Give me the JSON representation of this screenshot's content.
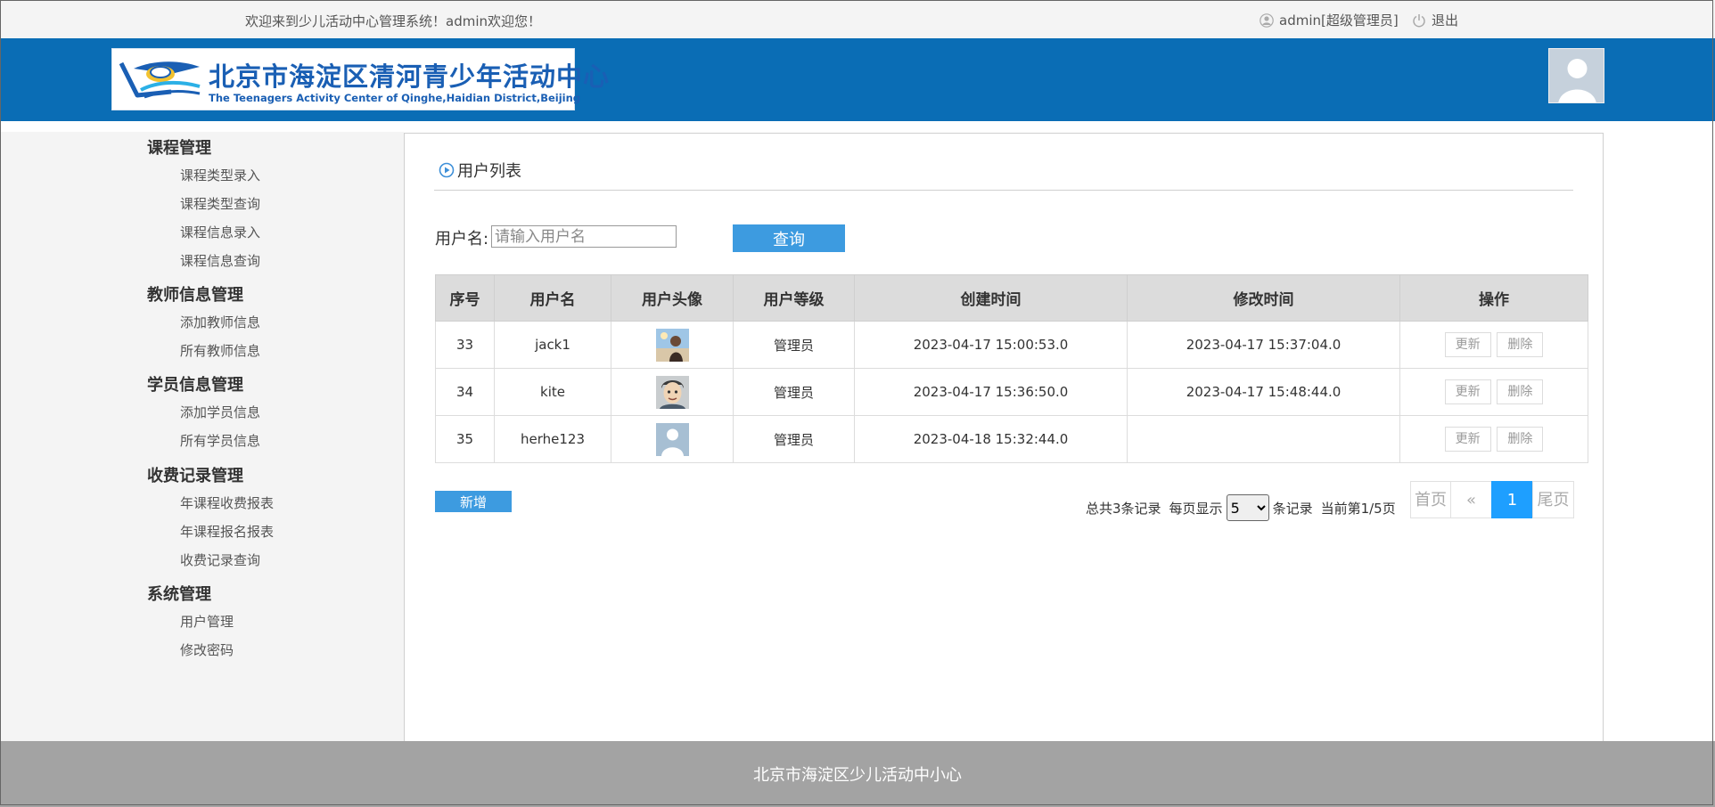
{
  "topbar": {
    "welcome": "欢迎来到少儿活动中心管理系统！admin欢迎您！",
    "user": "admin[超级管理员]",
    "logout": "退出"
  },
  "header": {
    "logo_cn": "北京市海淀区清河青少年活动中心",
    "logo_en": "The Teenagers Activity Center of Qinghe,Haidian District,Beijing"
  },
  "sidebar": {
    "groups": [
      {
        "title": "课程管理",
        "items": [
          "课程类型录入",
          "课程类型查询",
          "课程信息录入",
          "课程信息查询"
        ]
      },
      {
        "title": "教师信息管理",
        "items": [
          "添加教师信息",
          "所有教师信息"
        ]
      },
      {
        "title": "学员信息管理",
        "items": [
          "添加学员信息",
          "所有学员信息"
        ]
      },
      {
        "title": "收费记录管理",
        "items": [
          "年课程收费报表",
          "年课程报名报表",
          "收费记录查询"
        ]
      },
      {
        "title": "系统管理",
        "items": [
          "用户管理",
          "修改密码"
        ]
      }
    ]
  },
  "main": {
    "title": "用户列表",
    "search_label": "用户名:",
    "search_placeholder": "请输入用户名",
    "search_button": "查询",
    "columns": [
      "序号",
      "用户名",
      "用户头像",
      "用户等级",
      "创建时间",
      "修改时间",
      "操作"
    ],
    "rows": [
      {
        "id": "33",
        "username": "jack1",
        "avatar": "photo-avatar-icon",
        "level": "管理员",
        "created": "2023-04-17 15:00:53.0",
        "modified": "2023-04-17 15:37:04.0"
      },
      {
        "id": "34",
        "username": "kite",
        "avatar": "cartoon-avatar-icon",
        "level": "管理员",
        "created": "2023-04-17 15:36:50.0",
        "modified": "2023-04-17 15:48:44.0"
      },
      {
        "id": "35",
        "username": "herhe123",
        "avatar": "default-avatar-icon",
        "level": "管理员",
        "created": "2023-04-18 15:32:44.0",
        "modified": ""
      }
    ],
    "update_label": "更新",
    "delete_label": "删除",
    "add_button": "新增",
    "pager": {
      "total_text": "总共3条记录",
      "per_page_label": "每页显示",
      "per_page_value": "5",
      "per_page_suffix": "条记录",
      "current_text": "当前第1/5页",
      "first": "首页",
      "prev": "«",
      "current": "1",
      "last": "尾页"
    }
  },
  "footer": {
    "text": "北京市海淀区少儿活动中小心"
  },
  "colors": {
    "header_blue": "#0a6db5",
    "button_blue": "#3d9be0",
    "pager_active": "#1e9fff",
    "footer_gray": "#a3a3a3"
  }
}
